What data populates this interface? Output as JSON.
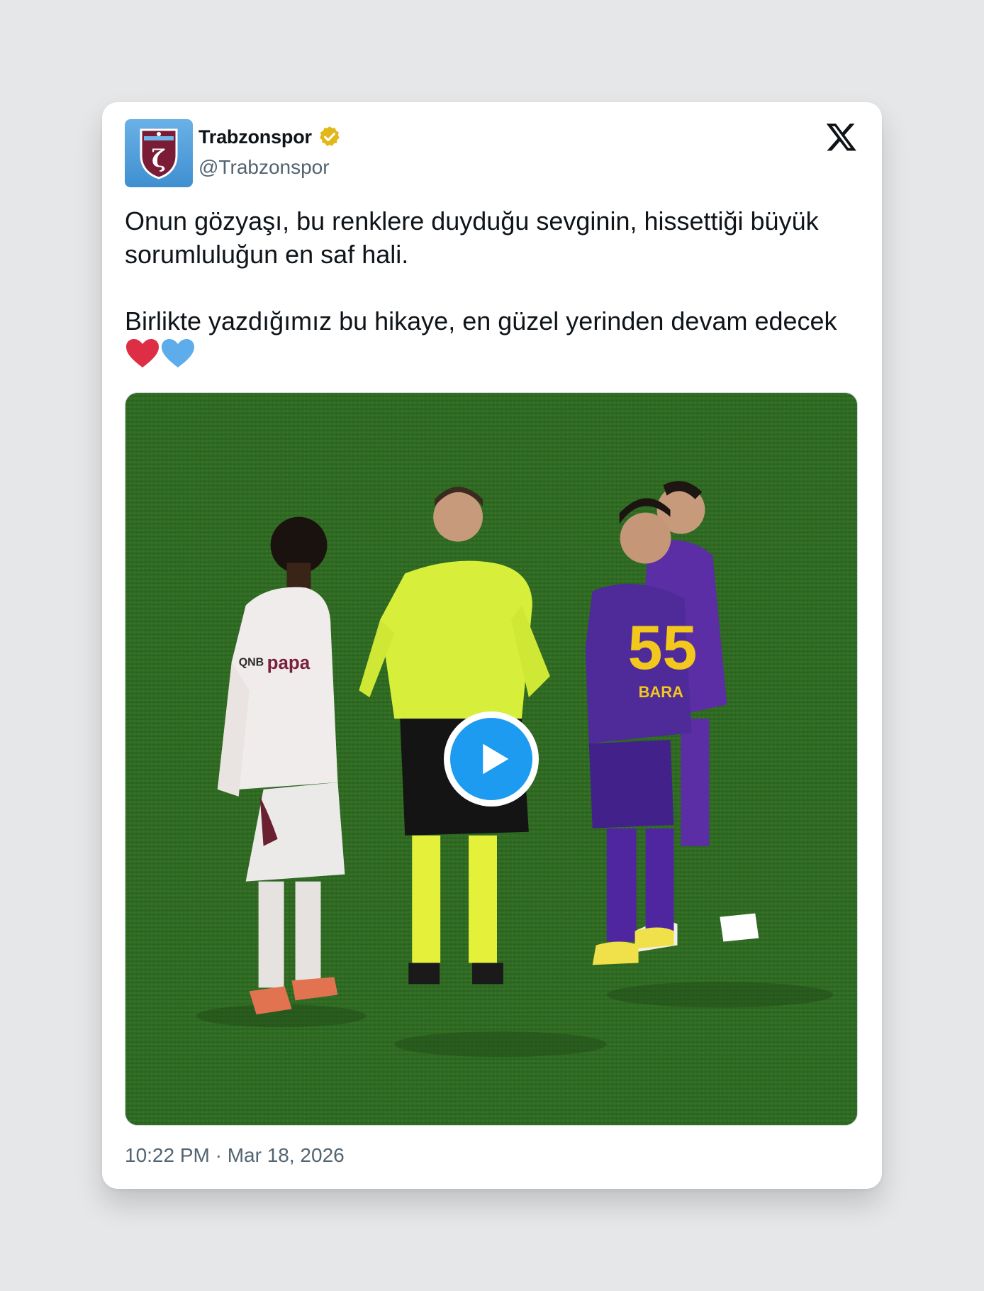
{
  "account": {
    "display_name": "Trabzonspor",
    "handle": "@Trabzonspor",
    "verified": true,
    "verified_badge_color": "#e2b719",
    "avatar_icon": "trabzonspor-crest-icon",
    "avatar_color": "#4f9fdc"
  },
  "platform_logo": "x-logo-icon",
  "tweet": {
    "paragraph_1": "Onun gözyaşı, bu renklere duyduğu sevginin, hissettiği büyük sorumluluğun en saf hali.",
    "paragraph_2": "Birlikte yazdığımız bu hikaye, en güzel yerinden devam edecek",
    "emojis": [
      "red-heart-icon",
      "blue-heart-icon"
    ]
  },
  "media": {
    "type": "video",
    "play_icon": "play-icon",
    "accent_color": "#1d9bf0",
    "pitch_color": "#2f6a22"
  },
  "timestamp": "10:22 PM · Mar 18, 2026"
}
